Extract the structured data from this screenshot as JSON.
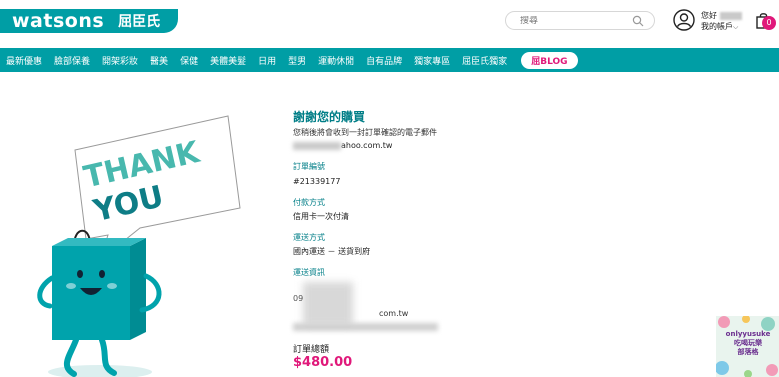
{
  "brand": {
    "logo_text": "watsons",
    "logo_cn": "屈臣氏"
  },
  "search": {
    "placeholder": "搜尋"
  },
  "account": {
    "greeting": "您好",
    "my_account": "我的帳戶"
  },
  "cart": {
    "count": "0"
  },
  "nav": {
    "items": [
      "最新優惠",
      "臉部保養",
      "開架彩妝",
      "醫美",
      "保健",
      "美體美髮",
      "日用",
      "型男",
      "運動休閒",
      "自有品牌",
      "獨家專區",
      "屈臣氏獨家"
    ],
    "blog_label": "BLOG"
  },
  "illustration": {
    "line1": "THANK",
    "line2": "YOU"
  },
  "order": {
    "title": "謝謝您的購買",
    "subtitle": "您稍後將會收到一封訂單確認的電子郵件",
    "email_visible": "ahoo.com.tw",
    "number_label": "訂單編號",
    "number_value": "#21339177",
    "payment_label": "付款方式",
    "payment_value": "信用卡一次付清",
    "delivery_label": "運送方式",
    "delivery_value": "國內運送 － 送貨到府",
    "shipping_label": "運送資訊",
    "shipping_partial_1": "09",
    "shipping_partial_2": "com.tw",
    "total_label": "訂單總額",
    "total_value": "$480.00"
  },
  "ad": {
    "line1": "onlyyusuke",
    "line2": "吃喝玩樂",
    "line3": "部落格"
  },
  "colors": {
    "brand_teal": "#009ea5",
    "accent_pink": "#e0187a",
    "heading_teal": "#007e87"
  }
}
